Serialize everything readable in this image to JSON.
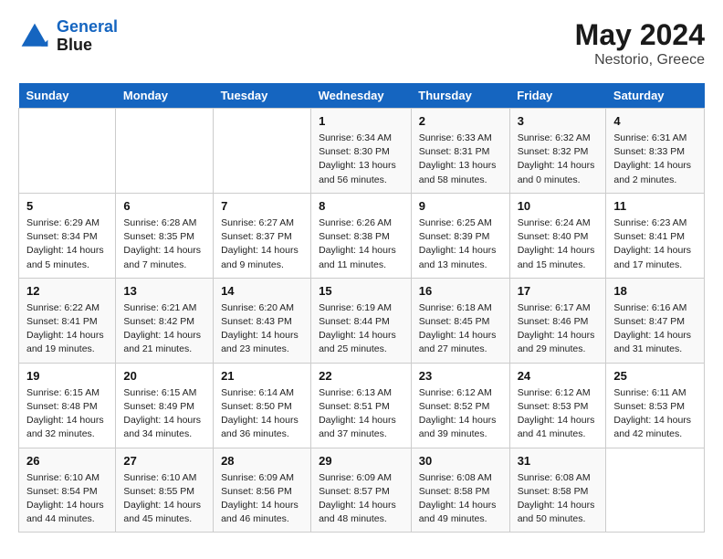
{
  "header": {
    "logo_line1": "General",
    "logo_line2": "Blue",
    "month_year": "May 2024",
    "location": "Nestorio, Greece"
  },
  "days_of_week": [
    "Sunday",
    "Monday",
    "Tuesday",
    "Wednesday",
    "Thursday",
    "Friday",
    "Saturday"
  ],
  "weeks": [
    [
      {
        "day": "",
        "info": ""
      },
      {
        "day": "",
        "info": ""
      },
      {
        "day": "",
        "info": ""
      },
      {
        "day": "1",
        "info": "Sunrise: 6:34 AM\nSunset: 8:30 PM\nDaylight: 13 hours\nand 56 minutes."
      },
      {
        "day": "2",
        "info": "Sunrise: 6:33 AM\nSunset: 8:31 PM\nDaylight: 13 hours\nand 58 minutes."
      },
      {
        "day": "3",
        "info": "Sunrise: 6:32 AM\nSunset: 8:32 PM\nDaylight: 14 hours\nand 0 minutes."
      },
      {
        "day": "4",
        "info": "Sunrise: 6:31 AM\nSunset: 8:33 PM\nDaylight: 14 hours\nand 2 minutes."
      }
    ],
    [
      {
        "day": "5",
        "info": "Sunrise: 6:29 AM\nSunset: 8:34 PM\nDaylight: 14 hours\nand 5 minutes."
      },
      {
        "day": "6",
        "info": "Sunrise: 6:28 AM\nSunset: 8:35 PM\nDaylight: 14 hours\nand 7 minutes."
      },
      {
        "day": "7",
        "info": "Sunrise: 6:27 AM\nSunset: 8:37 PM\nDaylight: 14 hours\nand 9 minutes."
      },
      {
        "day": "8",
        "info": "Sunrise: 6:26 AM\nSunset: 8:38 PM\nDaylight: 14 hours\nand 11 minutes."
      },
      {
        "day": "9",
        "info": "Sunrise: 6:25 AM\nSunset: 8:39 PM\nDaylight: 14 hours\nand 13 minutes."
      },
      {
        "day": "10",
        "info": "Sunrise: 6:24 AM\nSunset: 8:40 PM\nDaylight: 14 hours\nand 15 minutes."
      },
      {
        "day": "11",
        "info": "Sunrise: 6:23 AM\nSunset: 8:41 PM\nDaylight: 14 hours\nand 17 minutes."
      }
    ],
    [
      {
        "day": "12",
        "info": "Sunrise: 6:22 AM\nSunset: 8:41 PM\nDaylight: 14 hours\nand 19 minutes."
      },
      {
        "day": "13",
        "info": "Sunrise: 6:21 AM\nSunset: 8:42 PM\nDaylight: 14 hours\nand 21 minutes."
      },
      {
        "day": "14",
        "info": "Sunrise: 6:20 AM\nSunset: 8:43 PM\nDaylight: 14 hours\nand 23 minutes."
      },
      {
        "day": "15",
        "info": "Sunrise: 6:19 AM\nSunset: 8:44 PM\nDaylight: 14 hours\nand 25 minutes."
      },
      {
        "day": "16",
        "info": "Sunrise: 6:18 AM\nSunset: 8:45 PM\nDaylight: 14 hours\nand 27 minutes."
      },
      {
        "day": "17",
        "info": "Sunrise: 6:17 AM\nSunset: 8:46 PM\nDaylight: 14 hours\nand 29 minutes."
      },
      {
        "day": "18",
        "info": "Sunrise: 6:16 AM\nSunset: 8:47 PM\nDaylight: 14 hours\nand 31 minutes."
      }
    ],
    [
      {
        "day": "19",
        "info": "Sunrise: 6:15 AM\nSunset: 8:48 PM\nDaylight: 14 hours\nand 32 minutes."
      },
      {
        "day": "20",
        "info": "Sunrise: 6:15 AM\nSunset: 8:49 PM\nDaylight: 14 hours\nand 34 minutes."
      },
      {
        "day": "21",
        "info": "Sunrise: 6:14 AM\nSunset: 8:50 PM\nDaylight: 14 hours\nand 36 minutes."
      },
      {
        "day": "22",
        "info": "Sunrise: 6:13 AM\nSunset: 8:51 PM\nDaylight: 14 hours\nand 37 minutes."
      },
      {
        "day": "23",
        "info": "Sunrise: 6:12 AM\nSunset: 8:52 PM\nDaylight: 14 hours\nand 39 minutes."
      },
      {
        "day": "24",
        "info": "Sunrise: 6:12 AM\nSunset: 8:53 PM\nDaylight: 14 hours\nand 41 minutes."
      },
      {
        "day": "25",
        "info": "Sunrise: 6:11 AM\nSunset: 8:53 PM\nDaylight: 14 hours\nand 42 minutes."
      }
    ],
    [
      {
        "day": "26",
        "info": "Sunrise: 6:10 AM\nSunset: 8:54 PM\nDaylight: 14 hours\nand 44 minutes."
      },
      {
        "day": "27",
        "info": "Sunrise: 6:10 AM\nSunset: 8:55 PM\nDaylight: 14 hours\nand 45 minutes."
      },
      {
        "day": "28",
        "info": "Sunrise: 6:09 AM\nSunset: 8:56 PM\nDaylight: 14 hours\nand 46 minutes."
      },
      {
        "day": "29",
        "info": "Sunrise: 6:09 AM\nSunset: 8:57 PM\nDaylight: 14 hours\nand 48 minutes."
      },
      {
        "day": "30",
        "info": "Sunrise: 6:08 AM\nSunset: 8:58 PM\nDaylight: 14 hours\nand 49 minutes."
      },
      {
        "day": "31",
        "info": "Sunrise: 6:08 AM\nSunset: 8:58 PM\nDaylight: 14 hours\nand 50 minutes."
      },
      {
        "day": "",
        "info": ""
      }
    ]
  ]
}
